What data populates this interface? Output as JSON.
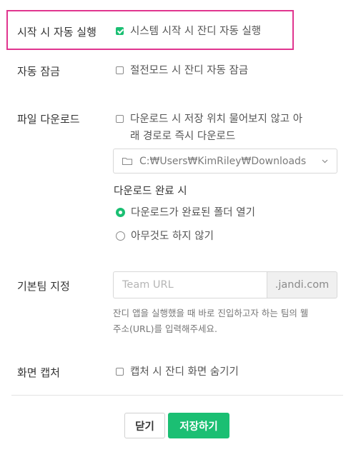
{
  "auto_start": {
    "label": "시작 시 자동 실행",
    "option": "시스템 시작 시 잔디 자동 실행",
    "checked": true
  },
  "auto_lock": {
    "label": "자동 잠금",
    "option": "절전모드 시 잔디 자동 잠금",
    "checked": false
  },
  "file_download": {
    "label": "파일 다운로드",
    "option_line1": "다운로드 시 저장 위치 물어보지 않고 아",
    "option_line2": "래 경로로 즉시 다운로드",
    "checked": false,
    "path": "C:₩Users₩KimRiley₩Downloads",
    "on_complete_label": "다운로드 완료 시",
    "radios": [
      {
        "label": "다운로드가 완료된 폴더 열기",
        "checked": true
      },
      {
        "label": "아무것도 하지 않기",
        "checked": false
      }
    ]
  },
  "default_team": {
    "label": "기본팀 지정",
    "placeholder": "Team URL",
    "suffix": ".jandi.com",
    "help_line1": "잔디 앱을 실행했을 때 바로 진입하고자 하는 팀의 웰",
    "help_line2": "주소(URL)를 입력해주세요."
  },
  "screen_capture": {
    "label": "화면 캡처",
    "option": "캡처 시 잔디 화면 숨기기",
    "checked": false
  },
  "footer": {
    "close_label": "닫기",
    "save_label": "저장하기"
  },
  "colors": {
    "accent": "#1bbf73",
    "highlight": "#e0358f"
  }
}
